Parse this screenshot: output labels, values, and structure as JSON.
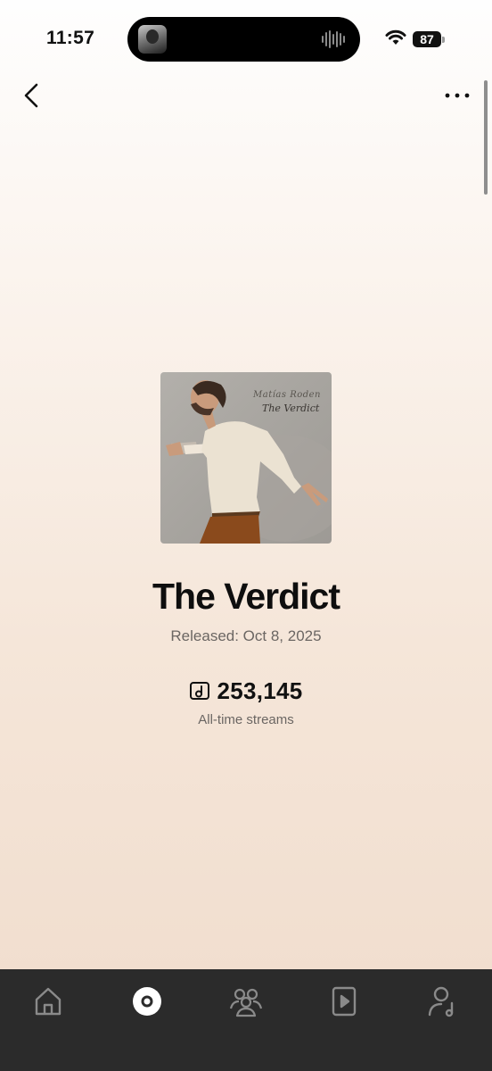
{
  "status_bar": {
    "time": "11:57",
    "battery": "87"
  },
  "release": {
    "cover_artist": "Matías Roden",
    "cover_title": "The Verdict",
    "title": "The Verdict",
    "released": "Released: Oct 8, 2025",
    "streams": "253,145",
    "streams_label": "All-time streams"
  },
  "nav": {
    "back_icon": "chevron-left-icon",
    "more_icon": "ellipsis-icon"
  },
  "tab_bar": {
    "tabs": [
      {
        "icon": "home-icon",
        "active": false
      },
      {
        "icon": "music-disc-icon",
        "active": true
      },
      {
        "icon": "audience-icon",
        "active": false
      },
      {
        "icon": "video-icon",
        "active": false
      },
      {
        "icon": "artist-profile-icon",
        "active": false
      }
    ]
  },
  "colors": {
    "tab_bar_bg": "#2b2b2b",
    "tab_icon": "#8a8a8a",
    "active_tab": "#ffffff"
  }
}
